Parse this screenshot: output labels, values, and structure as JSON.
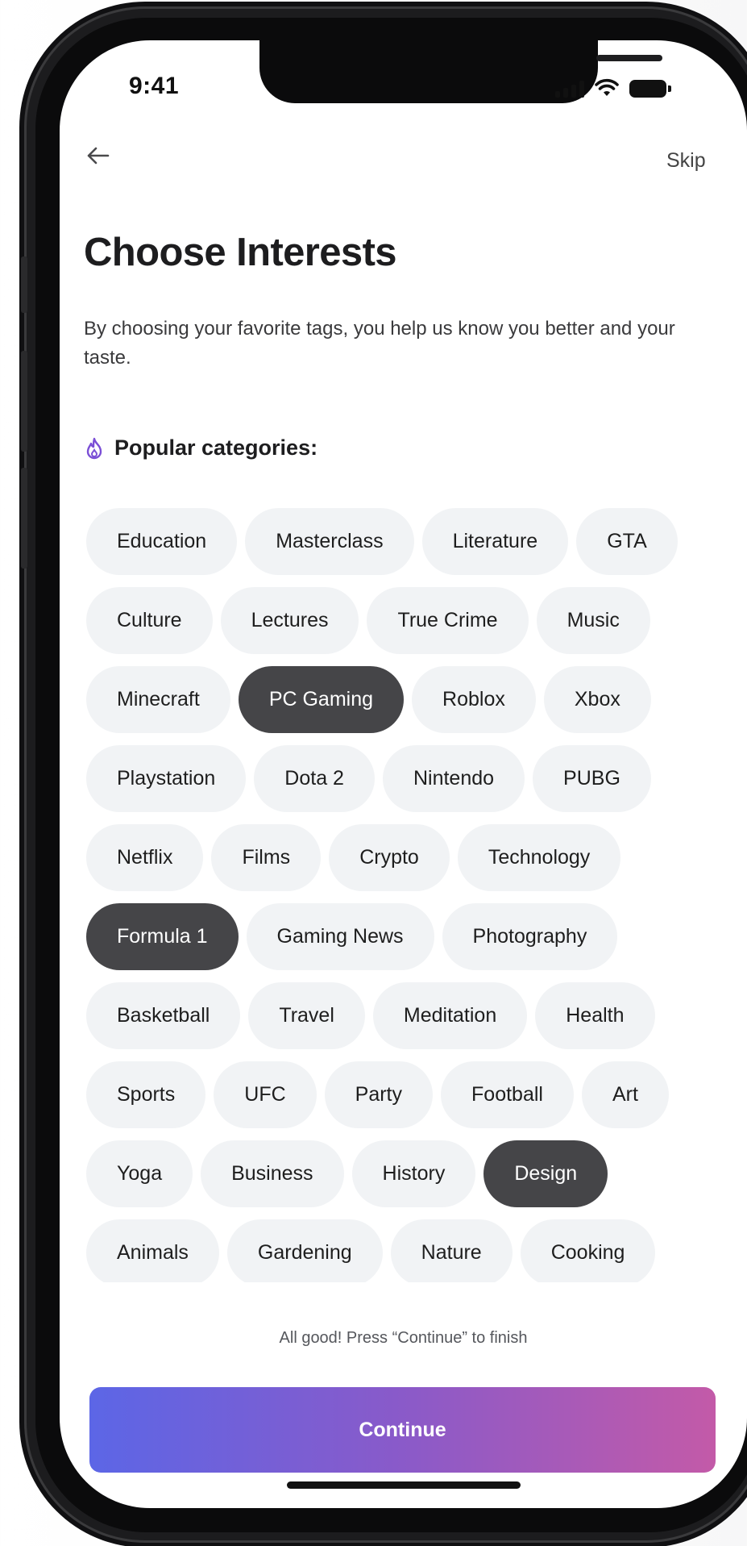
{
  "status_bar": {
    "time": "9:41"
  },
  "nav": {
    "back_icon": "arrow-left-icon",
    "skip_label": "Skip"
  },
  "header": {
    "title": "Choose Interests",
    "subtitle": "By choosing your favorite tags, you help us know you better and your taste."
  },
  "section": {
    "icon": "fire-icon",
    "label": "Popular categories:",
    "icon_color": "#7b4fd6"
  },
  "chips": [
    [
      {
        "label": "Education",
        "selected": false
      },
      {
        "label": "Masterclass",
        "selected": false
      },
      {
        "label": "Literature",
        "selected": false
      },
      {
        "label": "GTA",
        "selected": false
      }
    ],
    [
      {
        "label": "Culture",
        "selected": false
      },
      {
        "label": "Lectures",
        "selected": false
      },
      {
        "label": "True Crime",
        "selected": false
      },
      {
        "label": "Music",
        "selected": false
      }
    ],
    [
      {
        "label": "Minecraft",
        "selected": false
      },
      {
        "label": "PC Gaming",
        "selected": true
      },
      {
        "label": "Roblox",
        "selected": false
      },
      {
        "label": "Xbox",
        "selected": false
      }
    ],
    [
      {
        "label": "Playstation",
        "selected": false
      },
      {
        "label": "Dota 2",
        "selected": false
      },
      {
        "label": "Nintendo",
        "selected": false
      },
      {
        "label": "PUBG",
        "selected": false
      }
    ],
    [
      {
        "label": "Netflix",
        "selected": false
      },
      {
        "label": "Films",
        "selected": false
      },
      {
        "label": "Crypto",
        "selected": false
      },
      {
        "label": "Technology",
        "selected": false
      }
    ],
    [
      {
        "label": "Formula 1",
        "selected": true
      },
      {
        "label": "Gaming News",
        "selected": false
      },
      {
        "label": "Photography",
        "selected": false
      }
    ],
    [
      {
        "label": "Basketball",
        "selected": false
      },
      {
        "label": "Travel",
        "selected": false
      },
      {
        "label": "Meditation",
        "selected": false
      },
      {
        "label": "Health",
        "selected": false
      }
    ],
    [
      {
        "label": "Sports",
        "selected": false
      },
      {
        "label": "UFC",
        "selected": false
      },
      {
        "label": "Party",
        "selected": false
      },
      {
        "label": "Football",
        "selected": false
      },
      {
        "label": "Art",
        "selected": false
      }
    ],
    [
      {
        "label": "Yoga",
        "selected": false
      },
      {
        "label": "Business",
        "selected": false
      },
      {
        "label": "History",
        "selected": false
      },
      {
        "label": "Design",
        "selected": true
      }
    ],
    [
      {
        "label": "Animals",
        "selected": false
      },
      {
        "label": "Gardening",
        "selected": false
      },
      {
        "label": "Nature",
        "selected": false
      },
      {
        "label": "Cooking",
        "selected": false
      }
    ]
  ],
  "footer": {
    "hint": "All good! Press “Continue” to finish",
    "continue_label": "Continue"
  },
  "colors": {
    "chip_bg": "#f1f3f5",
    "chip_selected_bg": "#454548",
    "button_gradient_start": "#5c66e6",
    "button_gradient_end": "#c35aa8"
  }
}
